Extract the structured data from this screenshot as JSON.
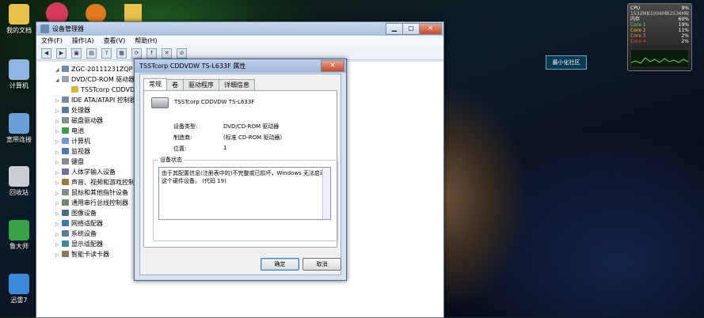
{
  "desktop": {
    "icons": [
      {
        "label": "我的文档",
        "color": "#e8c24a"
      },
      {
        "label": "计算机",
        "color": "#8fb6e0"
      },
      {
        "label": "宽带连接",
        "color": "#6aa0d8"
      },
      {
        "label": "回收站",
        "color": "#c9ced6"
      },
      {
        "label": "鲁大师",
        "color": "#3aa046"
      },
      {
        "label": "迅雷7",
        "color": "#3a8ad8"
      }
    ],
    "mini_gadget_label": "最小化社区"
  },
  "cpu_gadget": {
    "title": "CPU",
    "percent": "9%",
    "mem_label": "内存",
    "mem_values": [
      "1532MB",
      "1004MB",
      "2536MB"
    ],
    "mem_percent": "60%",
    "cores": [
      {
        "label": "Core 1",
        "value": "19%",
        "color": "#7fd35a"
      },
      {
        "label": "Core 2",
        "value": "11%",
        "color": "#f2c038"
      },
      {
        "label": "Core 3",
        "value": "2%",
        "color": "#e8893a"
      },
      {
        "label": "Core 4",
        "value": "2%",
        "color": "#e0463a"
      }
    ]
  },
  "device_manager": {
    "title": "设备管理器",
    "menu": [
      "文件(F)",
      "操作(A)",
      "查看(V)",
      "帮助(H)"
    ],
    "tree": [
      {
        "label": "ZGC-20111231ZQP",
        "level": 0,
        "expand": "◢",
        "color": "#6a8ab0"
      },
      {
        "label": "DVD/CD-ROM 驱动器",
        "level": 1,
        "expand": "◢",
        "color": "#9aa4b0"
      },
      {
        "label": "TSSTcorp CDDVDW TS-L633F",
        "level": 2,
        "expand": "",
        "color": "#d8b23a"
      },
      {
        "label": "IDE ATA/ATAPI 控制器",
        "level": 1,
        "expand": "▷",
        "color": "#7a8aa0"
      },
      {
        "label": "处理器",
        "level": 1,
        "expand": "▷",
        "color": "#5a7a9a"
      },
      {
        "label": "磁盘驱动器",
        "level": 1,
        "expand": "▷",
        "color": "#8a8a8a"
      },
      {
        "label": "电池",
        "level": 1,
        "expand": "▷",
        "color": "#3aa046"
      },
      {
        "label": "计算机",
        "level": 1,
        "expand": "▷",
        "color": "#6a9ad0"
      },
      {
        "label": "监视器",
        "level": 1,
        "expand": "▷",
        "color": "#4a7ab0"
      },
      {
        "label": "键盘",
        "level": 1,
        "expand": "▷",
        "color": "#8a8a8a"
      },
      {
        "label": "人体学输入设备",
        "level": 1,
        "expand": "▷",
        "color": "#7a6a9a"
      },
      {
        "label": "声音、视频和游戏控制器",
        "level": 1,
        "expand": "▷",
        "color": "#9a7a3a"
      },
      {
        "label": "鼠标和其他指针设备",
        "level": 1,
        "expand": "▷",
        "color": "#8a8a8a"
      },
      {
        "label": "通用串行总线控制器",
        "level": 1,
        "expand": "▷",
        "color": "#6a8a6a"
      },
      {
        "label": "图像设备",
        "level": 1,
        "expand": "▷",
        "color": "#4a6a8a"
      },
      {
        "label": "网络适配器",
        "level": 1,
        "expand": "▷",
        "color": "#3a7ab0"
      },
      {
        "label": "系统设备",
        "level": 1,
        "expand": "▷",
        "color": "#5a7a9a"
      },
      {
        "label": "显示适配器",
        "level": 1,
        "expand": "▷",
        "color": "#3a8a9a"
      },
      {
        "label": "智能卡读卡器",
        "level": 1,
        "expand": "▷",
        "color": "#8a7a5a"
      }
    ]
  },
  "properties": {
    "title": "TSSTcorp CDDVDW TS-L633F 属性",
    "tabs": [
      "常规",
      "卷",
      "驱动程序",
      "详细信息"
    ],
    "device_name": "TSSTcorp CDDVDW TS-L633F",
    "fields": [
      {
        "label": "设备类型:",
        "value": "DVD/CD-ROM 驱动器"
      },
      {
        "label": "制造商:",
        "value": "(标准 CD-ROM 驱动器)"
      },
      {
        "label": "位置:",
        "value": "1"
      }
    ],
    "status_group": "设备状态",
    "status_text": "由于其配置信息(注册表中的)不完整或已损坏，Windows 无法启动这个硬件设备。 (代码 19)",
    "ok_label": "确定",
    "cancel_label": "取消"
  }
}
